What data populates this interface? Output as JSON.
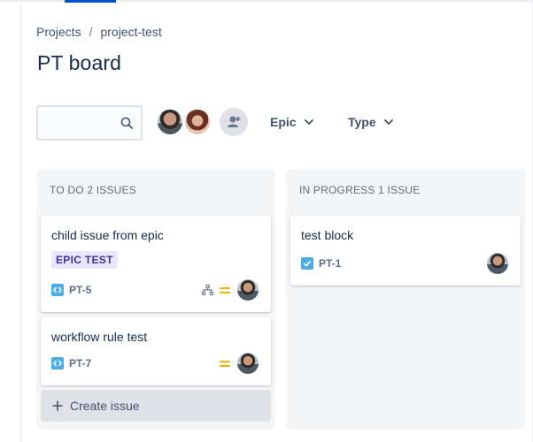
{
  "breadcrumb": {
    "root": "Projects",
    "separator": "/",
    "project": "project-test"
  },
  "page": {
    "title": "PT board"
  },
  "search": {
    "placeholder": "",
    "icon": "search-icon"
  },
  "filters": {
    "epic": "Epic",
    "type": "Type"
  },
  "columns": [
    {
      "header": "TO DO 2 ISSUES",
      "cards": [
        {
          "title": "child issue from epic",
          "epic": "EPIC TEST",
          "key": "PT-5",
          "type": "subtask",
          "priority": "medium"
        },
        {
          "title": "workflow rule test",
          "key": "PT-7",
          "type": "subtask",
          "priority": "medium"
        }
      ],
      "create_label": "Create issue"
    },
    {
      "header": "IN PROGRESS 1 ISSUE",
      "cards": [
        {
          "title": "test block",
          "key": "PT-1",
          "type": "task"
        }
      ]
    }
  ],
  "colors": {
    "accent": "#0052cc",
    "epic_bg": "#eae6ff",
    "epic_text": "#403294",
    "priority_medium": "#ffab00",
    "issue_type": "#4bade8"
  }
}
